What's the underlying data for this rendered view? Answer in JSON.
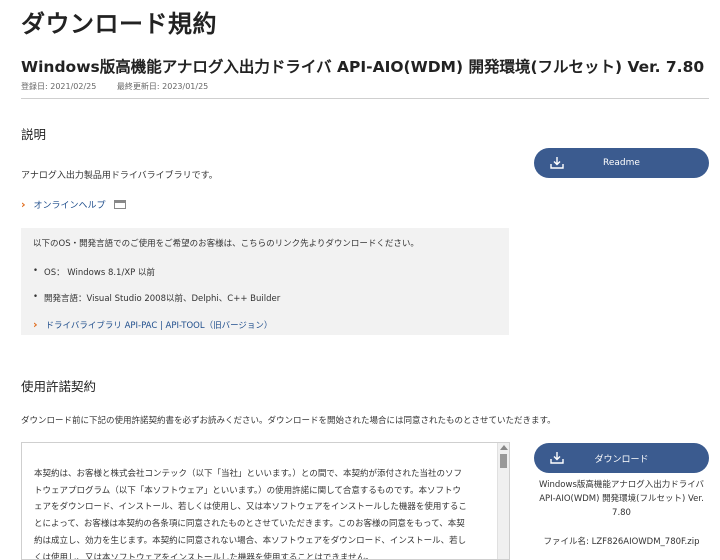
{
  "page_title": "ダウンロード規約",
  "product_title": "Windows版高機能アナログ入出力ドライバ API-AIO(WDM) 開発環境(フルセット) Ver. 7.80",
  "registered_date": "登録日: 2021/02/25",
  "updated_date": "最終更新日: 2023/01/25",
  "description": {
    "heading": "説明",
    "text": "アナログ入出力製品用ドライバライブラリです。",
    "help_link": "オンラインヘルプ"
  },
  "readme_button": "Readme",
  "os_box": {
    "intro": "以下のOS・開発言語でのご使用をご希望のお客様は、こちらのリンク先よりダウンロードください。",
    "items": [
      "OS： Windows 8.1/XP 以前",
      "開発言語：Visual Studio 2008以前、Delphi、C++ Builder"
    ],
    "old_link": "ドライバライブラリ API-PAC | API-TOOL（旧バージョン）"
  },
  "license": {
    "heading": "使用許諾契約",
    "intro": "ダウンロード前に下記の使用許諾契約書を必ずお読みください。ダウンロードを開始された場合には同意されたものとさせていただきます。",
    "lines": [
      "本契約は、お客様と株式会社コンテック（以下「当社」といいます。）との間で、本契約が添付された当社のソフ",
      "トウェアプログラム（以下「本ソフトウェア」といいます。）の使用許諾に関して合意するものです。本ソフトウ",
      "ェアをダウンロード、インストール、若しくは使用し、又は本ソフトウェアをインストールした機器を使用するこ",
      "とによって、お客様は本契約の各条項に同意されたものとさせていただきます。このお客様の同意をもって、本契",
      "約は成立し、効力を生じます。本契約に同意されない場合、本ソフトウェアをダウンロード、インストール、若し",
      "くは使用し、又は本ソフトウェアをインストールした機器を使用することはできません。"
    ]
  },
  "download": {
    "button": "ダウンロード",
    "info_lines": [
      "Windows版高機能アナログ入出力ドライバ",
      "API-AIO(WDM) 開発環境(フルセット) Ver.",
      "7.80"
    ],
    "file_name": "ファイル名: LZF826AIOWDM_780F.zip"
  },
  "colors": {
    "button": "#3b5b8f",
    "link": "#1f4e8c",
    "chevron": "#e06a1a",
    "box": "#f2f2f2"
  },
  "icons": [
    "download-icon",
    "chevron-right-icon",
    "external-window-icon",
    "scroll-up-icon"
  ]
}
